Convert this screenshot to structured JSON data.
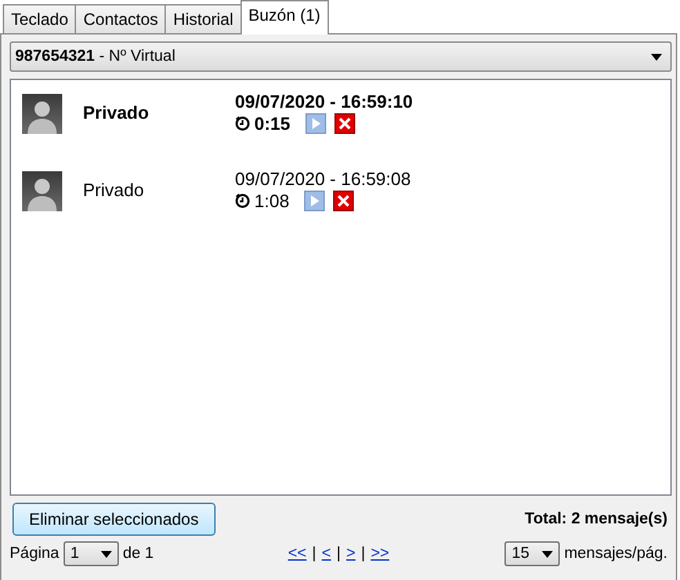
{
  "tabs": [
    {
      "label": "Teclado",
      "selected": false
    },
    {
      "label": "Contactos",
      "selected": false
    },
    {
      "label": "Historial",
      "selected": false
    },
    {
      "label": "Buzón (1)",
      "selected": true
    }
  ],
  "line_select": {
    "number": "987654321",
    "label": " - Nº Virtual"
  },
  "messages": [
    {
      "caller": "Privado",
      "datetime": "09/07/2020 - 16:59:10",
      "duration": "0:15",
      "unread": true
    },
    {
      "caller": "Privado",
      "datetime": "09/07/2020 - 16:59:08",
      "duration": "1:08",
      "unread": false
    }
  ],
  "delete_button": "Eliminar seleccionados",
  "total": "Total: 2 mensaje(s)",
  "pager": {
    "page_label": "Página",
    "page": "1",
    "of_label": "de 1",
    "nav": [
      {
        "kind": "link",
        "text": "<<"
      },
      {
        "kind": "sep",
        "text": "|"
      },
      {
        "kind": "link",
        "text": "<"
      },
      {
        "kind": "sep",
        "text": "|"
      },
      {
        "kind": "link",
        "text": ">"
      },
      {
        "kind": "sep",
        "text": "|"
      },
      {
        "kind": "link",
        "text": ">>"
      }
    ],
    "per_page": "15",
    "per_page_label": "mensajes/pág."
  }
}
